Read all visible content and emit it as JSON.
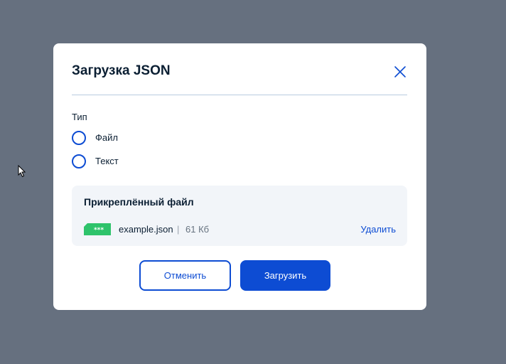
{
  "dialog": {
    "title": "Загрузка JSON",
    "type_label": "Тип",
    "radio_options": [
      {
        "label": "Файл",
        "selected": false
      },
      {
        "label": "Текст",
        "selected": false
      }
    ],
    "attached": {
      "title": "Прикреплённый файл",
      "file_name": "example.json",
      "separator": "|",
      "file_size": "61 Кб",
      "delete_label": "Удалить",
      "icon": "file-json-icon",
      "icon_text": "***"
    },
    "buttons": {
      "cancel_label": "Отменить",
      "upload_label": "Загрузить"
    }
  },
  "colors": {
    "overlay": "#66707f",
    "accent": "#0d4cd3",
    "text": "#0b1f33",
    "file_icon": "#2ec36b",
    "attach_bg": "#f2f5f9"
  }
}
